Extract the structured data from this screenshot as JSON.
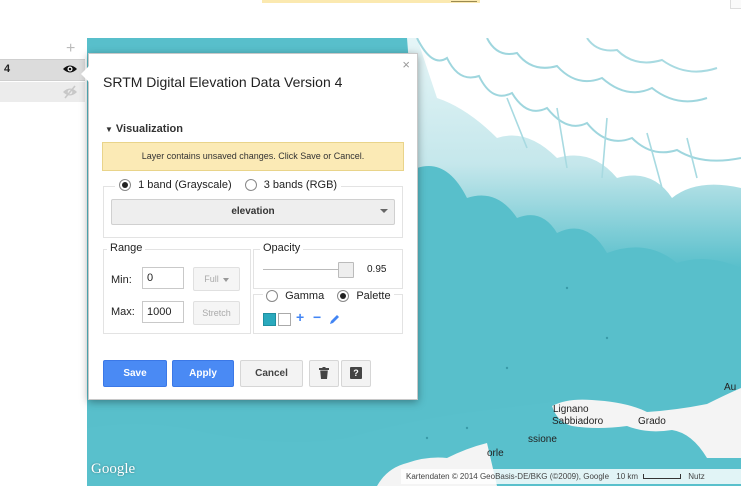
{
  "layers": {
    "active_label": "4"
  },
  "dialog": {
    "title": "SRTM Digital Elevation Data Version 4",
    "close_glyph": "×",
    "section": "Visualization",
    "warning": "Layer contains unsaved changes. Click Save or Cancel.",
    "bands": {
      "option1": "1 band (Grayscale)",
      "option2": "3 bands (RGB)",
      "selected_band": "elevation"
    },
    "range": {
      "label": "Range",
      "min_label": "Min:",
      "min_value": "0",
      "max_label": "Max:",
      "max_value": "1000",
      "full_label": "Full",
      "stretch_label": "Stretch"
    },
    "opacity": {
      "label": "Opacity",
      "value": "0.95",
      "level": 0.95
    },
    "palette": {
      "gamma_label": "Gamma",
      "palette_label": "Palette",
      "colors": [
        "#2aa9bd",
        "#ffffff"
      ],
      "add_glyph": "+",
      "remove_glyph": "−",
      "edit_icon": "pencil-icon"
    },
    "buttons": {
      "save": "Save",
      "apply": "Apply",
      "cancel": "Cancel",
      "delete_icon": "trash-icon",
      "help": "?"
    }
  },
  "map": {
    "brand": "Google",
    "labels": [
      "Lignano",
      "Sabbiadoro",
      "Grado",
      "Au",
      "orle",
      "ssione"
    ],
    "attribution": "Kartendaten © 2014 GeoBasis-DE/BKG (©2009), Google",
    "scale": "10 km",
    "terms": "Nutz"
  },
  "colors": {
    "water": "#58bfcb",
    "land_high": "#ffffff",
    "accent_blue": "#4a8af4",
    "warning_bg": "#fbeab5"
  }
}
